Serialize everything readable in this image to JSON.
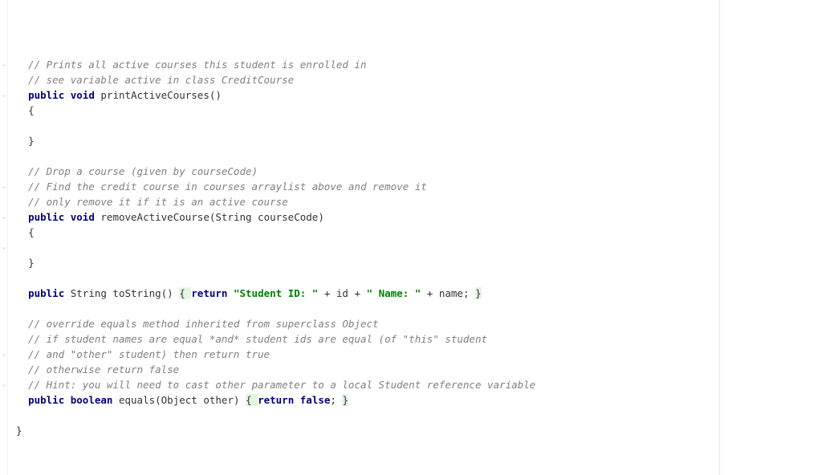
{
  "code": {
    "lines": [
      {
        "type": "comment",
        "indent": 2,
        "text": "// Prints all active courses this student is enrolled in"
      },
      {
        "type": "comment",
        "indent": 2,
        "text": "// see variable active in class CreditCourse"
      },
      {
        "type": "sig",
        "indent": 2,
        "parts": [
          [
            "keyword",
            "public "
          ],
          [
            "keyword",
            "void "
          ],
          [
            "identifier",
            "printActiveCourses()"
          ]
        ]
      },
      {
        "type": "plain",
        "indent": 2,
        "parts": [
          [
            "identifier",
            "{"
          ]
        ]
      },
      {
        "type": "blank"
      },
      {
        "type": "plain",
        "indent": 2,
        "parts": [
          [
            "identifier",
            "}"
          ]
        ]
      },
      {
        "type": "blank"
      },
      {
        "type": "comment",
        "indent": 2,
        "text": "// Drop a course (given by courseCode)"
      },
      {
        "type": "comment",
        "indent": 2,
        "text": "// Find the credit course in courses arraylist above and remove it"
      },
      {
        "type": "comment",
        "indent": 2,
        "text": "// only remove it if it is an active course"
      },
      {
        "type": "sig",
        "indent": 2,
        "parts": [
          [
            "keyword",
            "public "
          ],
          [
            "keyword",
            "void "
          ],
          [
            "identifier",
            "removeActiveCourse(String courseCode)"
          ]
        ]
      },
      {
        "type": "plain",
        "indent": 2,
        "parts": [
          [
            "identifier",
            "{"
          ]
        ]
      },
      {
        "type": "blank"
      },
      {
        "type": "plain",
        "indent": 2,
        "parts": [
          [
            "identifier",
            "}"
          ]
        ]
      },
      {
        "type": "blank"
      },
      {
        "type": "inline",
        "indent": 2,
        "parts": [
          [
            "keyword",
            "public "
          ],
          [
            "identifier",
            "String toString() "
          ],
          [
            "brace-hl",
            "{ "
          ],
          [
            "kw-hl",
            "return "
          ],
          [
            "string",
            "\"Student ID: \""
          ],
          [
            "identifier",
            " + id + "
          ],
          [
            "string",
            "\" Name: \""
          ],
          [
            "identifier",
            " + name; "
          ],
          [
            "brace-hl",
            "}"
          ]
        ]
      },
      {
        "type": "blank"
      },
      {
        "type": "comment",
        "indent": 2,
        "text": "// override equals method inherited from superclass Object"
      },
      {
        "type": "comment",
        "indent": 2,
        "text": "// if student names are equal *and* student ids are equal (of \"this\" student"
      },
      {
        "type": "comment",
        "indent": 2,
        "text": "// and \"other\" student) then return true"
      },
      {
        "type": "comment",
        "indent": 2,
        "text": "// otherwise return false"
      },
      {
        "type": "comment",
        "indent": 2,
        "text": "// Hint: you will need to cast other parameter to a local Student reference variable"
      },
      {
        "type": "inline",
        "indent": 2,
        "parts": [
          [
            "keyword",
            "public "
          ],
          [
            "keyword",
            "boolean "
          ],
          [
            "identifier",
            "equals(Object other) "
          ],
          [
            "brace-hl",
            "{ "
          ],
          [
            "kw-hl",
            "return "
          ],
          [
            "bool",
            "false"
          ],
          [
            "identifier",
            "; "
          ],
          [
            "brace-hl",
            "}"
          ]
        ]
      },
      {
        "type": "blank"
      },
      {
        "type": "plain",
        "indent": 0,
        "parts": [
          [
            "identifier",
            "}"
          ]
        ]
      }
    ],
    "fold_marks": [
      3,
      5,
      11,
      13,
      15,
      22,
      24
    ]
  }
}
